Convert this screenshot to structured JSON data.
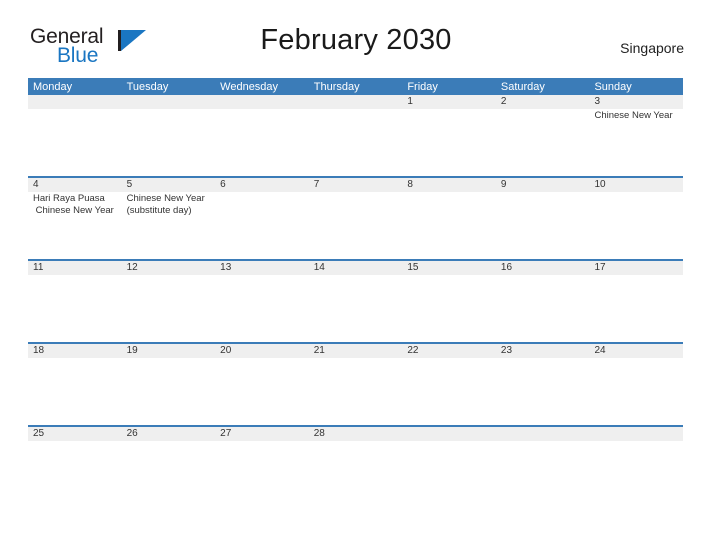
{
  "brand": {
    "name_top": "General",
    "name_bottom": "Blue",
    "flag_icon": "pennant-flag-icon",
    "accent_color": "#1a76c2"
  },
  "header": {
    "title": "February 2030",
    "locale": "Singapore"
  },
  "colors": {
    "header_blue": "#3b7cb8",
    "band_gray": "#efefef",
    "text": "#333333"
  },
  "calendar": {
    "weekdays": [
      "Monday",
      "Tuesday",
      "Wednesday",
      "Thursday",
      "Friday",
      "Saturday",
      "Sunday"
    ],
    "weeks": [
      [
        {
          "day": "",
          "events": []
        },
        {
          "day": "",
          "events": []
        },
        {
          "day": "",
          "events": []
        },
        {
          "day": "",
          "events": []
        },
        {
          "day": "1",
          "events": []
        },
        {
          "day": "2",
          "events": []
        },
        {
          "day": "3",
          "events": [
            "Chinese New Year"
          ]
        }
      ],
      [
        {
          "day": "4",
          "events": [
            "Hari Raya Puasa",
            " Chinese New Year"
          ]
        },
        {
          "day": "5",
          "events": [
            "Chinese New Year (substitute day)"
          ]
        },
        {
          "day": "6",
          "events": []
        },
        {
          "day": "7",
          "events": []
        },
        {
          "day": "8",
          "events": []
        },
        {
          "day": "9",
          "events": []
        },
        {
          "day": "10",
          "events": []
        }
      ],
      [
        {
          "day": "11",
          "events": []
        },
        {
          "day": "12",
          "events": []
        },
        {
          "day": "13",
          "events": []
        },
        {
          "day": "14",
          "events": []
        },
        {
          "day": "15",
          "events": []
        },
        {
          "day": "16",
          "events": []
        },
        {
          "day": "17",
          "events": []
        }
      ],
      [
        {
          "day": "18",
          "events": []
        },
        {
          "day": "19",
          "events": []
        },
        {
          "day": "20",
          "events": []
        },
        {
          "day": "21",
          "events": []
        },
        {
          "day": "22",
          "events": []
        },
        {
          "day": "23",
          "events": []
        },
        {
          "day": "24",
          "events": []
        }
      ],
      [
        {
          "day": "25",
          "events": []
        },
        {
          "day": "26",
          "events": []
        },
        {
          "day": "27",
          "events": []
        },
        {
          "day": "28",
          "events": []
        },
        {
          "day": "",
          "events": []
        },
        {
          "day": "",
          "events": []
        },
        {
          "day": "",
          "events": []
        }
      ]
    ]
  }
}
